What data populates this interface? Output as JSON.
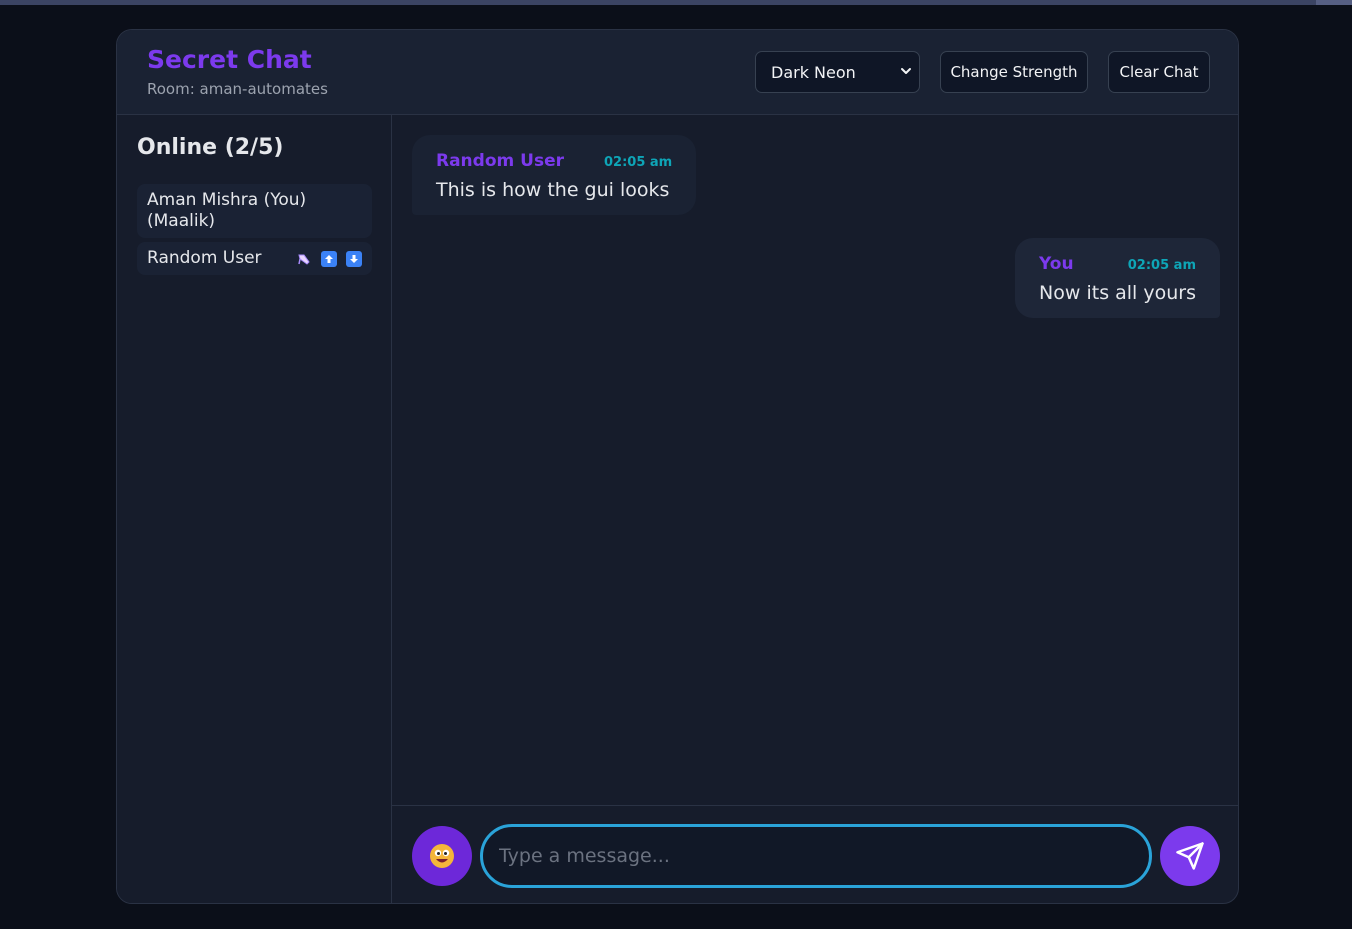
{
  "app": {
    "title": "Secret Chat",
    "room": "Room: aman-automates"
  },
  "header": {
    "theme_select": {
      "selected": "Dark Neon",
      "icon": "chevron-down-icon"
    },
    "change_strength_label": "Change Strength",
    "clear_chat_label": "Clear Chat"
  },
  "sidebar": {
    "online_title": "Online (2/5)",
    "users": [
      {
        "name": "Aman Mishra (You) (Maalik)",
        "actions": []
      },
      {
        "name": "Random User",
        "actions": [
          "kick-icon",
          "promote-icon",
          "demote-icon"
        ]
      }
    ]
  },
  "messages": [
    {
      "sender": "Random User",
      "time": "02:05 am",
      "text": "This is how the gui looks",
      "direction": "incoming"
    },
    {
      "sender": "You",
      "time": "02:05 am",
      "text": "Now its all yours",
      "direction": "outgoing"
    }
  ],
  "composer": {
    "placeholder": "Type a message...",
    "value": "",
    "emoji_icon": "smiley-emoji-icon",
    "send_icon": "send-icon"
  },
  "colors": {
    "accent": "#7c3aed",
    "time": "#0ea5b7",
    "input_border": "#2aa3d9",
    "background": "#0b0f19"
  }
}
